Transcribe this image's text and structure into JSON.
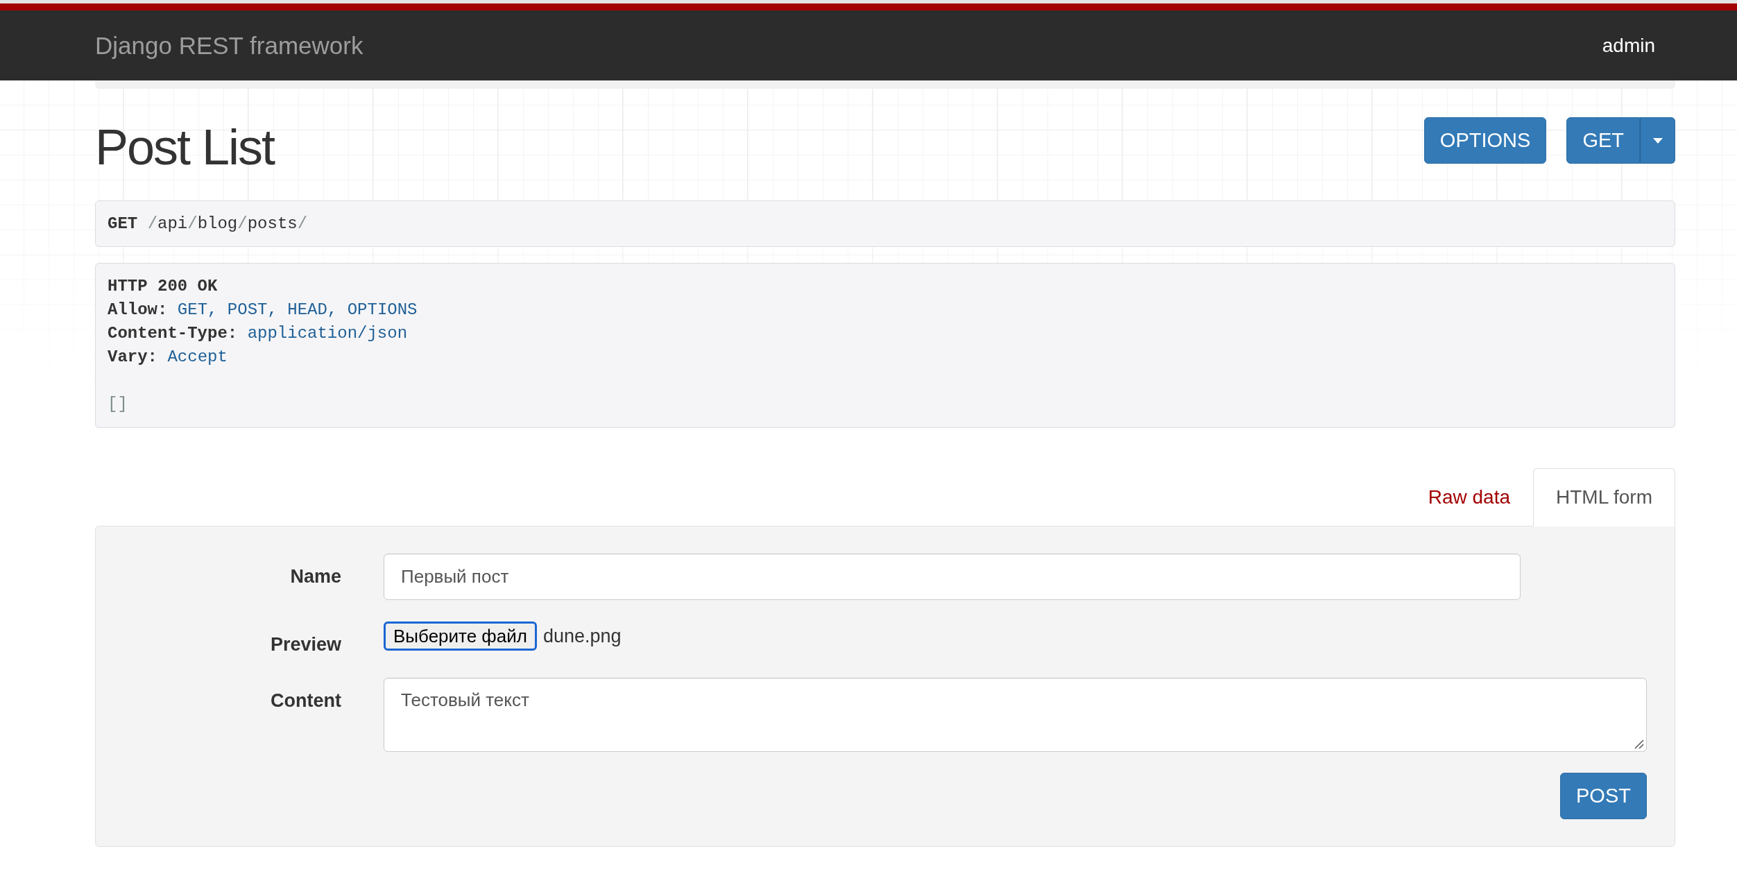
{
  "navbar": {
    "brand": "Django REST framework",
    "user": "admin"
  },
  "header": {
    "title": "Post List",
    "actions": [
      {
        "kind": "button",
        "label": "OPTIONS"
      },
      {
        "kind": "split",
        "label": "GET"
      }
    ]
  },
  "request": {
    "method": "GET",
    "path": "/api/blog/posts/"
  },
  "response": {
    "status": "HTTP 200 OK",
    "headers": [
      {
        "name": "Allow:",
        "value": "GET, POST, HEAD, OPTIONS"
      },
      {
        "name": "Content-Type:",
        "value": "application/json"
      },
      {
        "name": "Vary:",
        "value": "Accept"
      }
    ],
    "body": "[]"
  },
  "tabs": [
    {
      "label": "Raw data",
      "selected": false
    },
    {
      "label": "HTML form",
      "selected": true
    }
  ],
  "form": {
    "fields": [
      {
        "kind": "text",
        "label": "Name",
        "value": "Первый пост"
      },
      {
        "kind": "file",
        "label": "Preview",
        "button": "Выберите файл",
        "file_name": "dune.png",
        "focused": true
      },
      {
        "kind": "textarea",
        "label": "Content",
        "value": "Тестовый текст"
      }
    ],
    "submit": "POST"
  }
}
